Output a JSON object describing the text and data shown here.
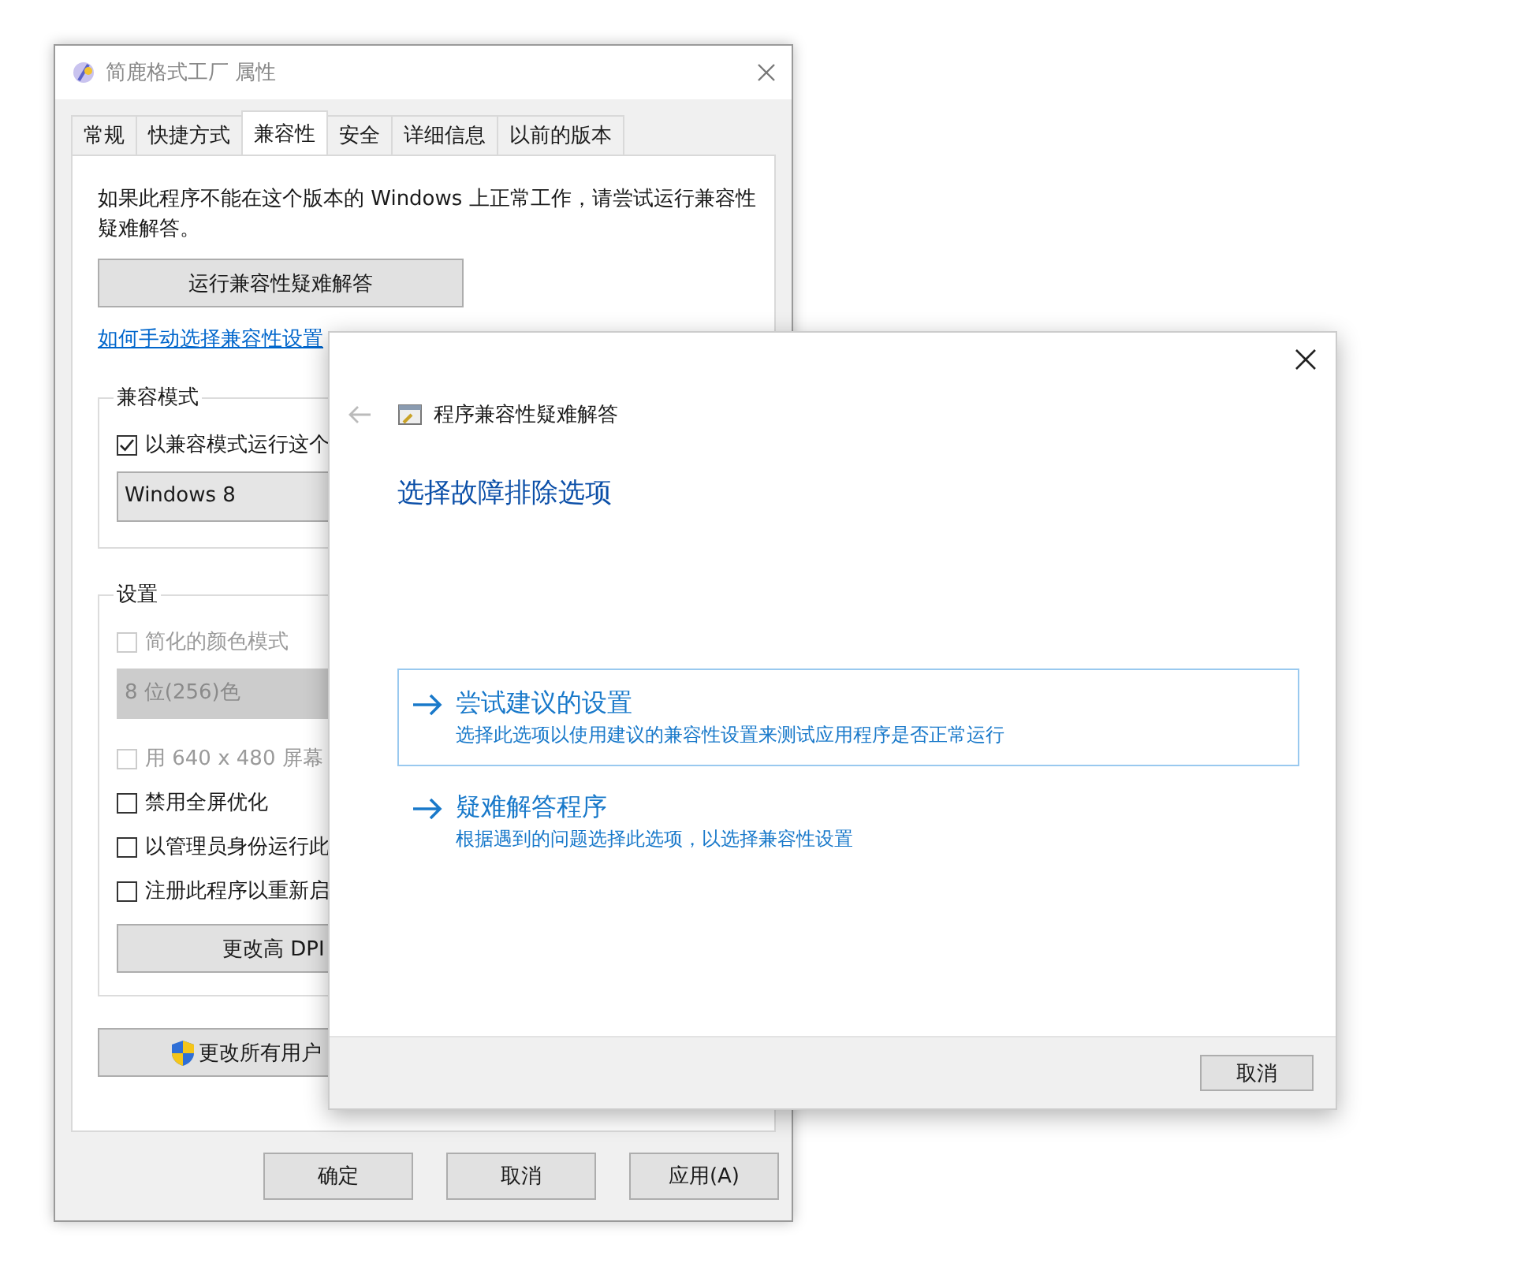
{
  "properties_window": {
    "title": "简鹿格式工厂 属性",
    "tabs": [
      {
        "label": "常规",
        "selected": false
      },
      {
        "label": "快捷方式",
        "selected": false
      },
      {
        "label": "兼容性",
        "selected": true
      },
      {
        "label": "安全",
        "selected": false
      },
      {
        "label": "详细信息",
        "selected": false
      },
      {
        "label": "以前的版本",
        "selected": false
      }
    ],
    "intro": "如果此程序不能在这个版本的 Windows 上正常工作，请尝试运行兼容性疑难解答。",
    "troubleshoot_button": "运行兼容性疑难解答",
    "help_link": "如何手动选择兼容性设置",
    "groups": [
      {
        "title": "兼容模式",
        "items": [
          {
            "kind": "checkbox",
            "label": "以兼容模式运行这个",
            "checked": true,
            "disabled": false
          },
          {
            "kind": "combo",
            "value": "Windows 8",
            "disabled": false
          }
        ]
      },
      {
        "title": "设置",
        "items": [
          {
            "kind": "checkbox",
            "label": "简化的颜色模式",
            "checked": false,
            "disabled": true
          },
          {
            "kind": "combo",
            "value": "8 位(256)色",
            "disabled": true
          },
          {
            "kind": "checkbox",
            "label": "用 640 x 480 屏幕",
            "checked": false,
            "disabled": true
          },
          {
            "kind": "checkbox",
            "label": "禁用全屏优化",
            "checked": false,
            "disabled": false
          },
          {
            "kind": "checkbox",
            "label": "以管理员身份运行此",
            "checked": false,
            "disabled": false
          },
          {
            "kind": "checkbox",
            "label": "注册此程序以重新启",
            "checked": false,
            "disabled": false
          },
          {
            "kind": "button",
            "label": "更改高 DPI"
          }
        ]
      }
    ],
    "all_users_button": "更改所有用户",
    "buttons": [
      "确定",
      "取消",
      "应用(A)"
    ]
  },
  "troubleshooter": {
    "title": "程序兼容性疑难解答",
    "heading": "选择故障排除选项",
    "options": [
      {
        "title": "尝试建议的设置",
        "description": "选择此选项以使用建议的兼容性设置来测试应用程序是否正常运行",
        "selected": true
      },
      {
        "title": "疑难解答程序",
        "description": "根据遇到的问题选择此选项，以选择兼容性设置",
        "selected": false
      }
    ],
    "cancel_button": "取消"
  }
}
